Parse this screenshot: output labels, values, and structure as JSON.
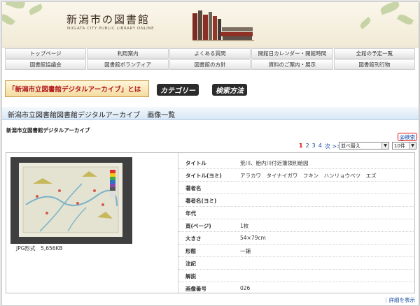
{
  "header": {
    "title": "新潟市の図書館",
    "subtitle": "NIIGATA CITY PUBLIC LIBRARY ONLINE"
  },
  "nav": {
    "row1": [
      "トップページ",
      "利用案内",
      "よくある質問",
      "開館日カレンダー・開館時間",
      "全館の予定一覧"
    ],
    "row2": [
      "図書館協議会",
      "図書館ボランティア",
      "図書館の方針",
      "資料のご案内・展示",
      "図書館刊行物"
    ]
  },
  "banners": {
    "about": "「新潟市立図書館デジタルアーカイブ」とは",
    "category": "カテゴリー",
    "search_method": "検索方法"
  },
  "page_title": "新潟市立図書館図書館デジタルアーカイブ　画像一覧",
  "breadcrumb": "新潟市立図書館デジタルアーカイブ",
  "search_link": "@検索",
  "pagination": {
    "current": "1",
    "pages": [
      "2",
      "3",
      "4"
    ],
    "next": "次 >>"
  },
  "sort_select": "並べ替え",
  "count_select": "10件",
  "item": {
    "file_info": "JPG形式　5,656KB",
    "fields": [
      {
        "label": "タイトル",
        "value": "荒川、胎内川付近藩領別絵図"
      },
      {
        "label": "タイトル(ヨミ)",
        "value": "アラカワ　タイナイガワ　フキン　ハンリョウベツ　エズ"
      },
      {
        "label": "著者名",
        "value": ""
      },
      {
        "label": "著者名(ヨミ)",
        "value": ""
      },
      {
        "label": "年代",
        "value": ""
      },
      {
        "label": "頁(ページ)",
        "value": "1枚"
      },
      {
        "label": "大きさ",
        "value": "54×79cm"
      },
      {
        "label": "形態",
        "value": "一鋪"
      },
      {
        "label": "注記",
        "value": ""
      },
      {
        "label": "解説",
        "value": ""
      },
      {
        "label": "画像番号",
        "value": "026"
      }
    ]
  },
  "detail_link": "｜詳細を表示"
}
